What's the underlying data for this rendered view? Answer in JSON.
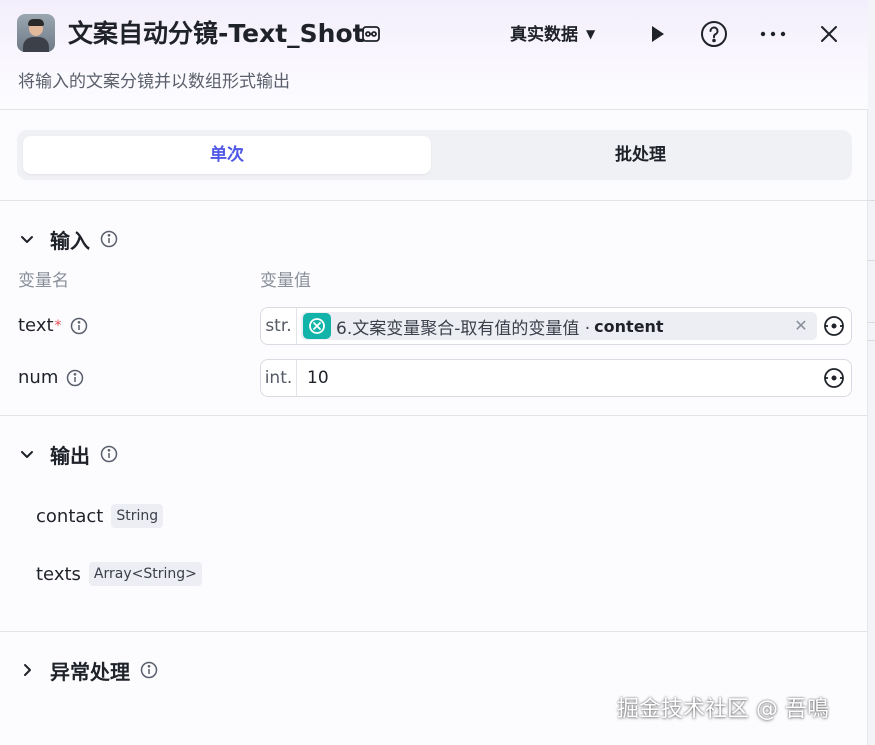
{
  "header": {
    "title": "文案自动分镜-Text_Shot",
    "subtitle": "将输入的文案分镜并以数组形式输出",
    "data_mode": "真实数据"
  },
  "tabs": [
    {
      "label": "单次",
      "active": true
    },
    {
      "label": "批处理",
      "active": false
    }
  ],
  "input": {
    "title": "输入",
    "col_name": "变量名",
    "col_value": "变量值",
    "rows": [
      {
        "name": "text",
        "required_mark": "*",
        "type": "str.",
        "ref_text": "6.文案变量聚合-取有值的变量值 ·",
        "ref_var": "content"
      },
      {
        "name": "num",
        "type": "int.",
        "value": "10"
      }
    ]
  },
  "output": {
    "title": "输出",
    "items": [
      {
        "name": "contact",
        "type": "String"
      },
      {
        "name": "texts",
        "type": "Array<String>"
      }
    ]
  },
  "exception": {
    "title": "异常处理"
  },
  "watermark": "掘金技术社区 @ 吾鳴",
  "colors": {
    "accent": "#4e57e6",
    "node": "#12b3a8",
    "required": "#e5484d"
  }
}
